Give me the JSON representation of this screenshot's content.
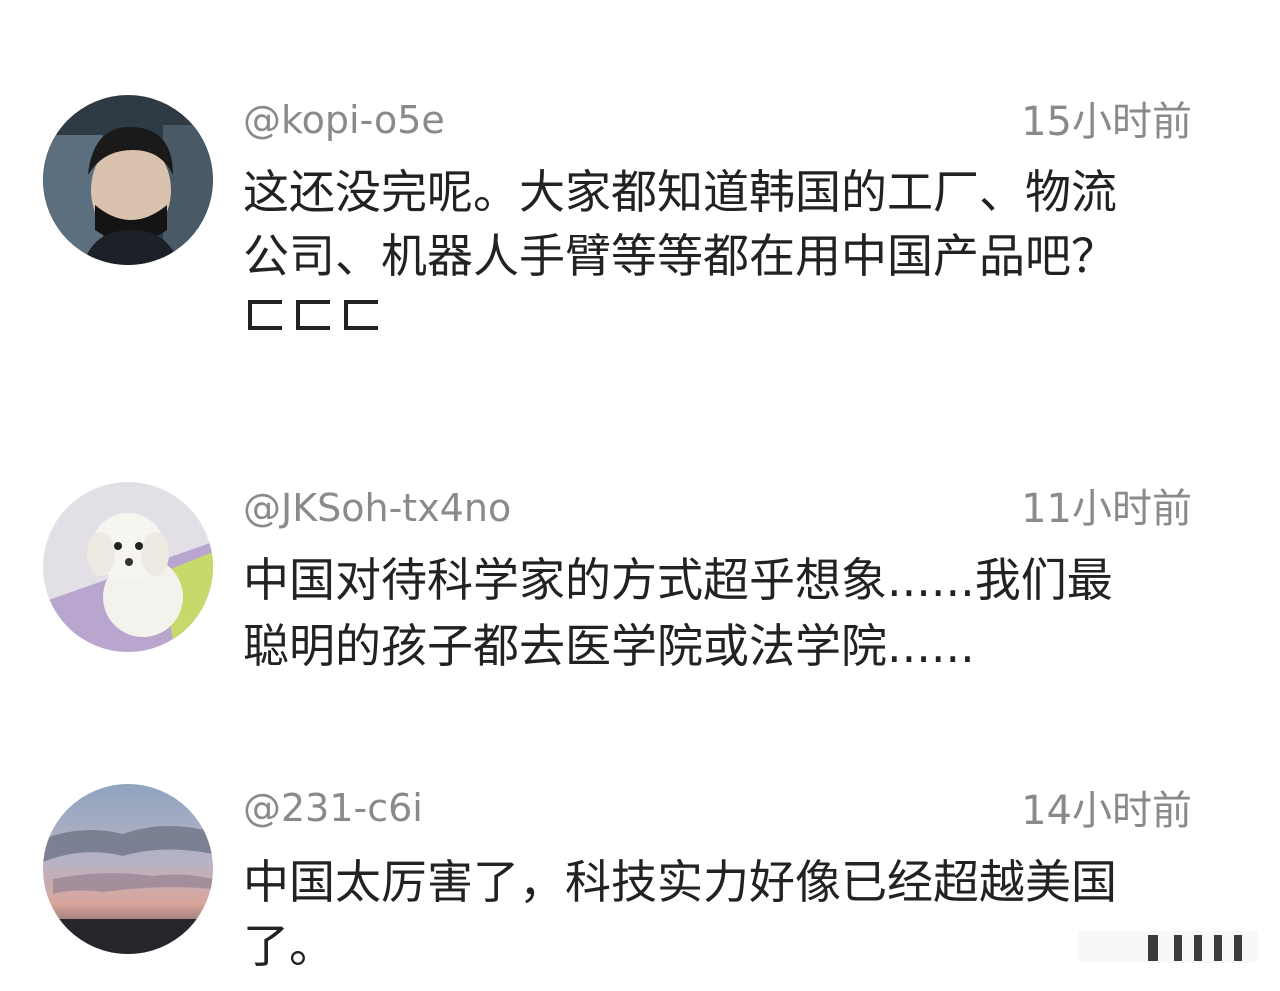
{
  "comments": [
    {
      "username": "@kopi-o5e",
      "timestamp": "15小时前",
      "lines": [
        "这还没完呢。大家都知道韩国的工厂、物流",
        "公司、机器人手臂等等都在用中国产品吧？"
      ],
      "emoji_count": 3
    },
    {
      "username": "@JKSoh-tx4no",
      "timestamp": "11小时前",
      "lines": [
        "中国对待科学家的方式超乎想象......我们最",
        "聪明的孩子都去医学院或法学院......"
      ]
    },
    {
      "username": "@231-c6i",
      "timestamp": "14小时前",
      "lines": [
        "中国太厉害了，科技实力好像已经超越美国",
        "了。"
      ]
    }
  ],
  "icons": {
    "avatar_1": "person-avatar",
    "avatar_2": "dog-avatar",
    "avatar_3": "sky-avatar",
    "watermark": "watermark-logo"
  },
  "colors": {
    "meta_text": "#8a8a8a",
    "body_text": "#222222",
    "background": "#ffffff"
  }
}
